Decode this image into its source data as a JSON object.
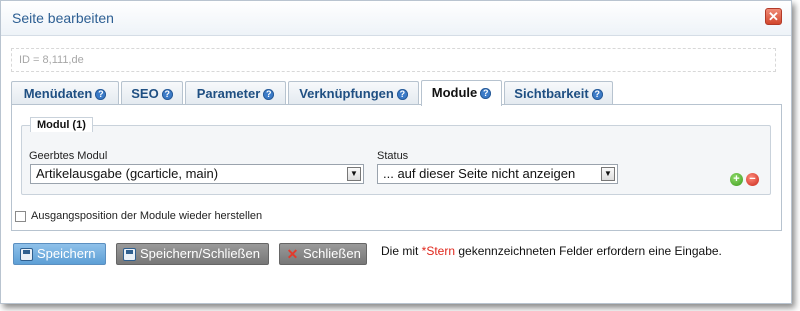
{
  "dialog": {
    "title": "Seite bearbeiten",
    "close_icon": "close-icon"
  },
  "id_field": {
    "value": "ID = 8,111,de"
  },
  "tabs": [
    {
      "label": "Menüdaten",
      "active": false
    },
    {
      "label": "SEO",
      "active": false
    },
    {
      "label": "Parameter",
      "active": false
    },
    {
      "label": "Verknüpfungen",
      "active": false
    },
    {
      "label": "Module",
      "active": true
    },
    {
      "label": "Sichtbarkeit",
      "active": false
    }
  ],
  "module_group": {
    "legend": "Modul (1)",
    "module_label": "Geerbtes Modul",
    "module_value": "Artikelausgabe (gcarticle, main)",
    "status_label": "Status",
    "status_value": "... auf dieser Seite nicht anzeigen"
  },
  "reset_checkbox": {
    "label": "Ausgangsposition der Module wieder herstellen",
    "checked": false
  },
  "buttons": {
    "save": "Speichern",
    "save_close": "Speichern/Schließen",
    "close": "Schließen"
  },
  "required_note": {
    "prefix": "Die mit ",
    "star": "*Stern",
    "suffix": " gekennzeichneten Felder erfordern eine Eingabe."
  },
  "colors": {
    "accent": "#2d5f93",
    "save_button": "#6aa8db",
    "required_star": "#e0261b"
  }
}
